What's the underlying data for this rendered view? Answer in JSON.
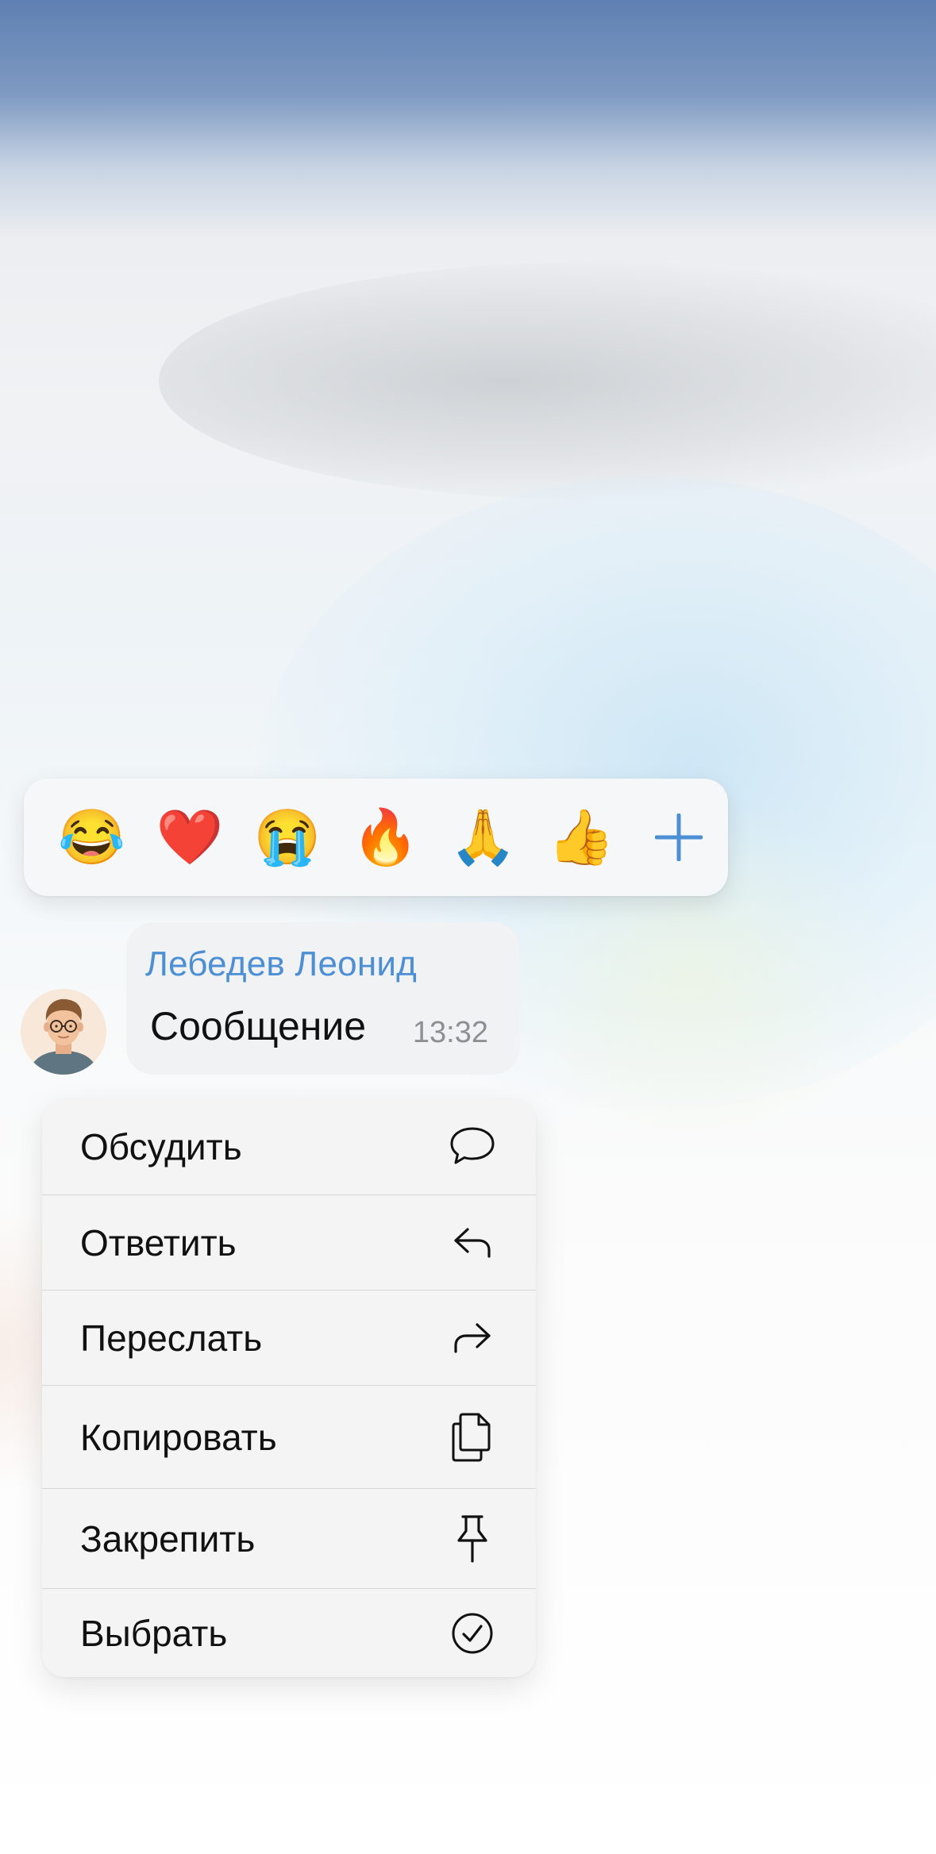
{
  "reactions": {
    "items": [
      "😂",
      "❤️",
      "😭",
      "🔥",
      "🙏",
      "👍"
    ],
    "add_icon": "plus-icon",
    "accent_color": "#4c8fd4"
  },
  "message": {
    "sender": "Лебедев Леонид",
    "text": "Сообщение",
    "time": "13:32",
    "sender_color": "#4c8fd4"
  },
  "menu": {
    "items": [
      {
        "label": "Обсудить",
        "icon": "speech-bubble-icon"
      },
      {
        "label": "Ответить",
        "icon": "reply-arrow-icon"
      },
      {
        "label": "Переслать",
        "icon": "forward-arrow-icon"
      },
      {
        "label": "Копировать",
        "icon": "copy-documents-icon"
      },
      {
        "label": "Закрепить",
        "icon": "pin-icon"
      },
      {
        "label": "Выбрать",
        "icon": "checkmark-circle-icon"
      }
    ]
  }
}
